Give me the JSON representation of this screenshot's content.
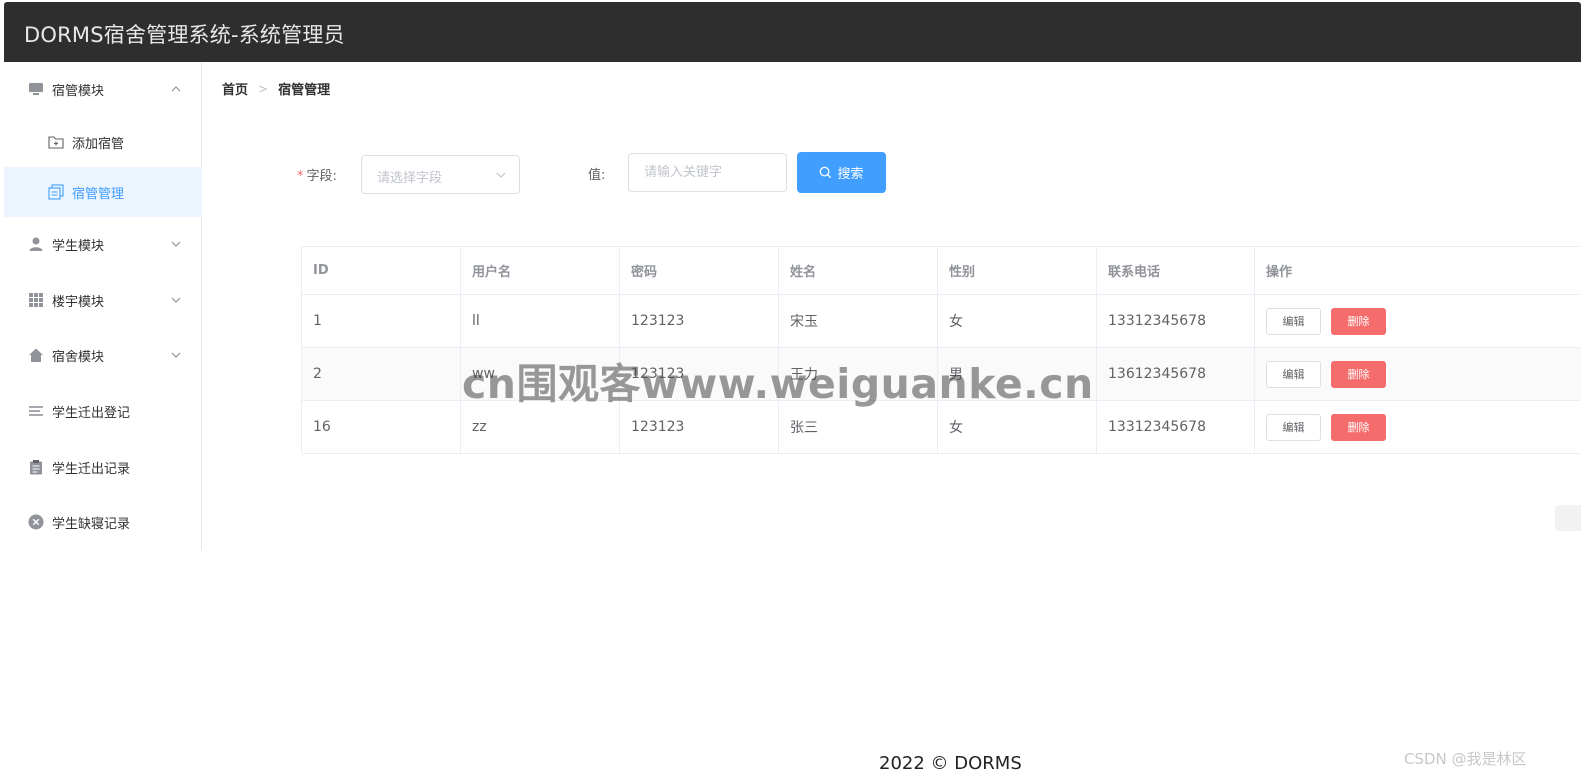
{
  "header": {
    "title": "DORMS宿舍管理系统-系统管理员"
  },
  "sidebar": {
    "items": [
      {
        "label": "宿管模块",
        "icon": "monitor-icon",
        "expanded": true,
        "children": [
          {
            "label": "添加宿管",
            "icon": "folder-add-icon",
            "active": false
          },
          {
            "label": "宿管管理",
            "icon": "copy-document-icon",
            "active": true
          }
        ]
      },
      {
        "label": "学生模块",
        "icon": "user-icon",
        "expanded": false
      },
      {
        "label": "楼宇模块",
        "icon": "grid-icon",
        "expanded": false
      },
      {
        "label": "宿舍模块",
        "icon": "house-icon",
        "expanded": false
      },
      {
        "label": "学生迁出登记",
        "icon": "list-icon"
      },
      {
        "label": "学生迁出记录",
        "icon": "clipboard-icon"
      },
      {
        "label": "学生缺寝记录",
        "icon": "circle-close-icon"
      }
    ]
  },
  "breadcrumb": {
    "home": "首页",
    "current": "宿管管理"
  },
  "search": {
    "field_label": "字段:",
    "field_placeholder": "请选择字段",
    "value_label": "值:",
    "value_placeholder": "请输入关键字",
    "button_label": "搜索"
  },
  "table": {
    "columns": [
      "ID",
      "用户名",
      "密码",
      "姓名",
      "性别",
      "联系电话",
      "操作"
    ],
    "rows": [
      {
        "id": "1",
        "username": "ll",
        "password": "123123",
        "name": "宋玉",
        "gender": "女",
        "phone": "13312345678"
      },
      {
        "id": "2",
        "username": "ww",
        "password": "123123",
        "name": "王力",
        "gender": "男",
        "phone": "13612345678"
      },
      {
        "id": "16",
        "username": "zz",
        "password": "123123",
        "name": "张三",
        "gender": "女",
        "phone": "13312345678"
      }
    ],
    "edit_label": "编辑",
    "delete_label": "删除"
  },
  "watermark": "cn围观客www.weiguanke.cn",
  "footer": {
    "text": "2022 © DORMS"
  },
  "corner_mark": "CSDN @我是林区",
  "colors": {
    "primary": "#409eff",
    "danger": "#f56c6c",
    "topbar": "#2e2e2e",
    "active_bg": "#ecf5ff"
  }
}
